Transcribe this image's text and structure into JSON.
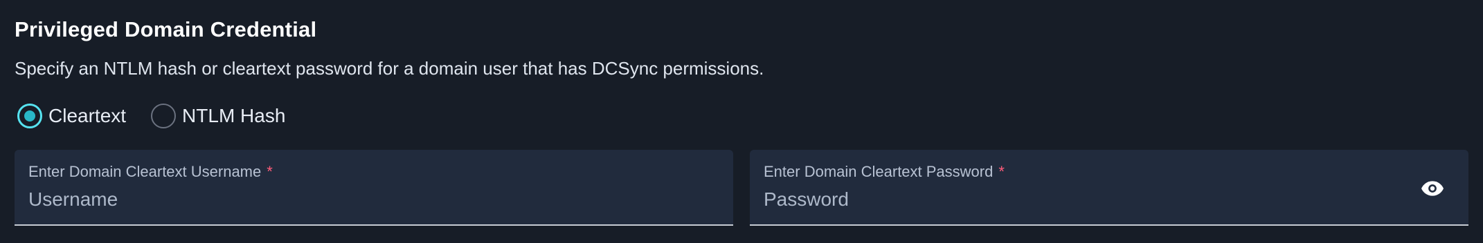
{
  "section": {
    "title": "Privileged Domain Credential",
    "description": "Specify an NTLM hash or cleartext password for a domain user that has DCSync permissions."
  },
  "credential_type": {
    "options": [
      {
        "label": "Cleartext",
        "selected": true
      },
      {
        "label": "NTLM Hash",
        "selected": false
      }
    ]
  },
  "username_field": {
    "label": "Enter Domain Cleartext Username",
    "required_marker": "*",
    "placeholder": "Username",
    "value": ""
  },
  "password_field": {
    "label": "Enter Domain Cleartext Password",
    "required_marker": "*",
    "placeholder": "Password",
    "value": "",
    "toggle_icon": "eye-icon"
  },
  "colors": {
    "background": "#171d27",
    "field_background": "#212b3d",
    "accent": "#56e3f0",
    "required": "#ff5c7a"
  }
}
